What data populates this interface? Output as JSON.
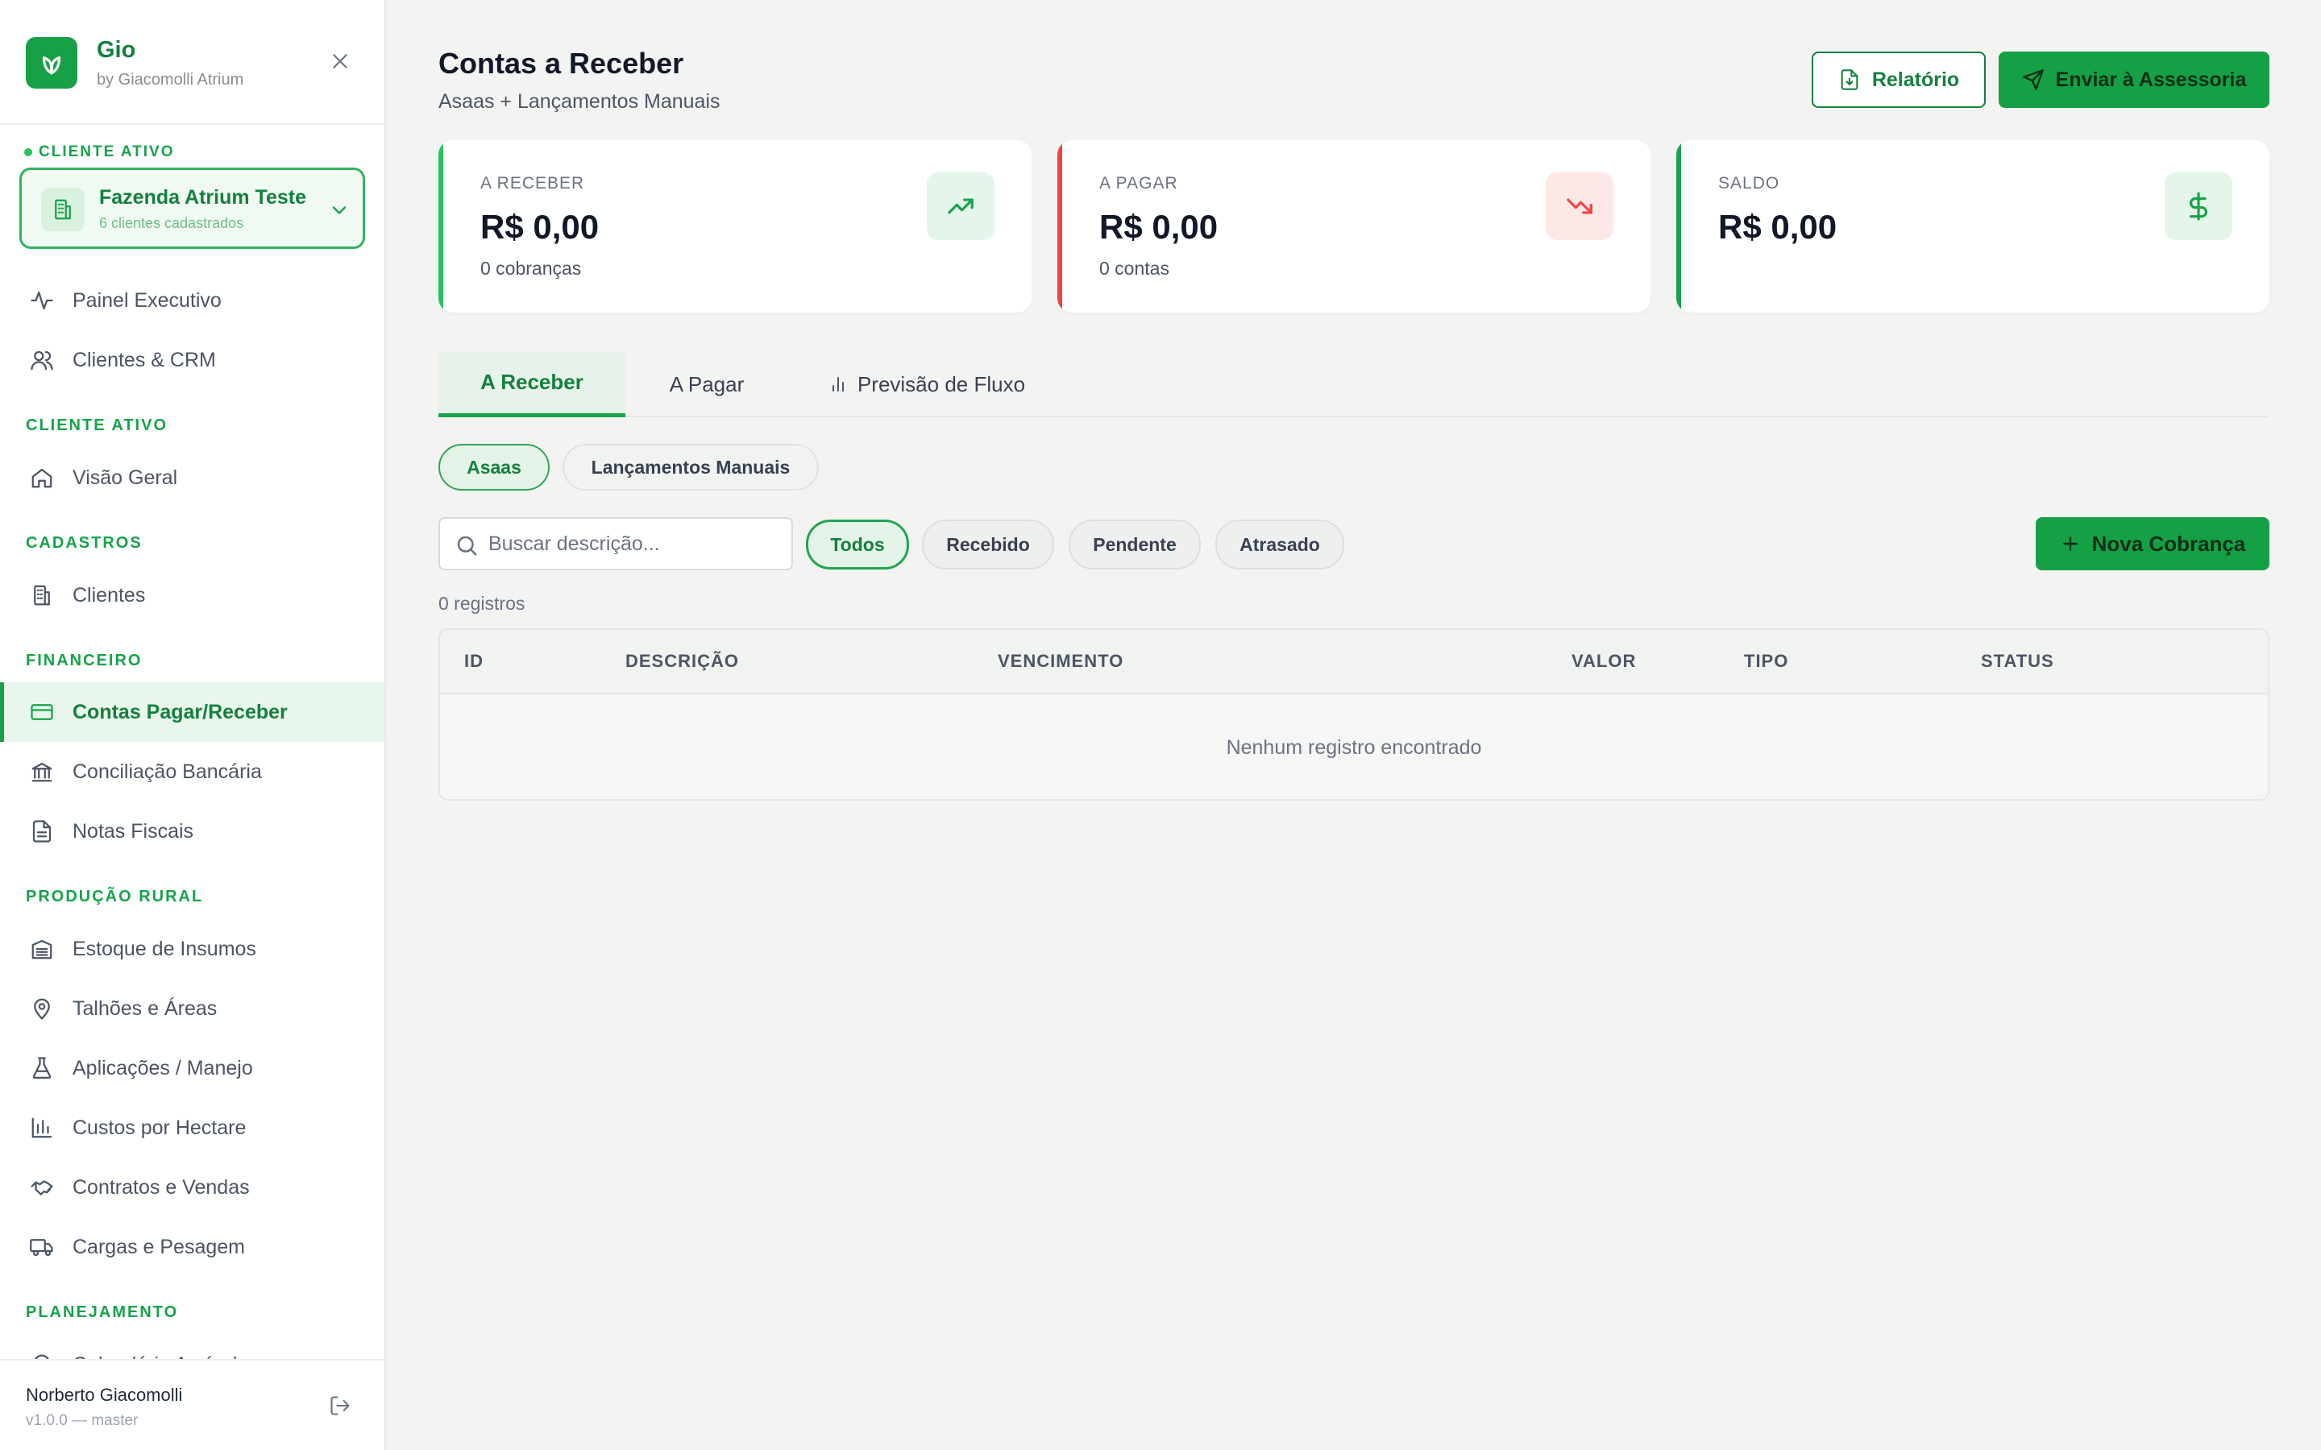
{
  "brand": {
    "name": "Gio",
    "subtitle": "by Giacomolli Atrium"
  },
  "active_client": {
    "label": "CLIENTE ATIVO",
    "name": "Fazenda Atrium Teste",
    "count": "6 clientes cadastrados"
  },
  "sidebar": {
    "top_items": [
      {
        "label": "Painel Executivo",
        "icon": "activity-icon"
      },
      {
        "label": "Clientes & CRM",
        "icon": "users-icon"
      }
    ],
    "sections": [
      {
        "title": "CLIENTE ATIVO",
        "items": [
          {
            "label": "Visão Geral",
            "icon": "home-icon"
          }
        ]
      },
      {
        "title": "CADASTROS",
        "items": [
          {
            "label": "Clientes",
            "icon": "building-icon"
          }
        ]
      },
      {
        "title": "FINANCEIRO",
        "items": [
          {
            "label": "Contas Pagar/Receber",
            "icon": "credit-card-icon",
            "active": true
          },
          {
            "label": "Conciliação Bancária",
            "icon": "bank-icon"
          },
          {
            "label": "Notas Fiscais",
            "icon": "file-text-icon"
          }
        ]
      },
      {
        "title": "PRODUÇÃO RURAL",
        "items": [
          {
            "label": "Estoque de Insumos",
            "icon": "warehouse-icon"
          },
          {
            "label": "Talhões e Áreas",
            "icon": "map-pin-icon"
          },
          {
            "label": "Aplicações / Manejo",
            "icon": "flask-icon"
          },
          {
            "label": "Custos por Hectare",
            "icon": "bar-chart-icon"
          },
          {
            "label": "Contratos e Vendas",
            "icon": "handshake-icon"
          },
          {
            "label": "Cargas e Pesagem",
            "icon": "truck-icon"
          }
        ]
      },
      {
        "title": "PLANEJAMENTO",
        "items": [
          {
            "label": "Calendário Agrícola",
            "icon": "map-pin-icon"
          }
        ]
      }
    ]
  },
  "user": {
    "name": "Norberto Giacomolli",
    "version": "v1.0.0 — master"
  },
  "header": {
    "title": "Contas a Receber",
    "subtitle": "Asaas + Lançamentos Manuais",
    "report_label": "Relatório",
    "send_label": "Enviar à Assessoria"
  },
  "kpis": [
    {
      "label": "A RECEBER",
      "value": "R$ 0,00",
      "sub": "0 cobranças",
      "accent": "#22c55e",
      "icon": "trending-up-icon"
    },
    {
      "label": "A PAGAR",
      "value": "R$ 0,00",
      "sub": "0 contas",
      "accent": "#ef4444",
      "icon": "trending-down-icon"
    },
    {
      "label": "SALDO",
      "value": "R$ 0,00",
      "sub": "",
      "accent": "#16a34a",
      "icon": "dollar-icon"
    }
  ],
  "tabs": [
    {
      "label": "A Receber",
      "active": true
    },
    {
      "label": "A Pagar",
      "active": false
    },
    {
      "label": "Previsão de Fluxo",
      "active": false
    }
  ],
  "segments": [
    {
      "label": "Asaas",
      "active": true
    },
    {
      "label": "Lançamentos Manuais",
      "active": false
    }
  ],
  "search": {
    "placeholder": "Buscar descrição..."
  },
  "filters": [
    {
      "label": "Todos",
      "active": true
    },
    {
      "label": "Recebido",
      "active": false
    },
    {
      "label": "Pendente",
      "active": false
    },
    {
      "label": "Atrasado",
      "active": false
    }
  ],
  "new_charge_label": "Nova Cobrança",
  "record_count": "0 registros",
  "table": {
    "columns": [
      "ID",
      "DESCRIÇÃO",
      "VENCIMENTO",
      "VALOR",
      "TIPO",
      "STATUS"
    ],
    "empty_message": "Nenhum registro encontrado"
  },
  "colors": {
    "brand": "#16a045",
    "positive": "#22c55e",
    "negative": "#ef4444"
  }
}
